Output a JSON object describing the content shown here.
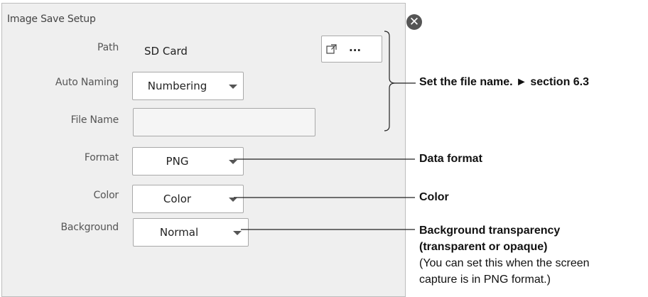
{
  "dialog": {
    "title": "Image Save Setup",
    "close_icon": "close-icon"
  },
  "fields": {
    "path_label": "Path",
    "path_value": "SD Card",
    "browse_label": "...",
    "auto_naming_label": "Auto Naming",
    "auto_naming_value": "Numbering",
    "file_name_label": "File Name",
    "file_name_value": "",
    "format_label": "Format",
    "format_value": "PNG",
    "color_label": "Color",
    "color_value": "Color",
    "background_label": "Background",
    "background_value": "Normal"
  },
  "callouts": {
    "file_name_note": "Set the file name. ► section 6.3",
    "format_note": "Data format",
    "color_note": "Color",
    "background_note_line1": "Background transparency",
    "background_note_line2": "(transparent or opaque)",
    "background_note_line3": "(You can set this when the screen",
    "background_note_line4": "capture is in PNG format.)"
  },
  "colors": {
    "dialog_bg": "#efefef",
    "border": "#a9a9a9",
    "close_bg": "#555555"
  }
}
